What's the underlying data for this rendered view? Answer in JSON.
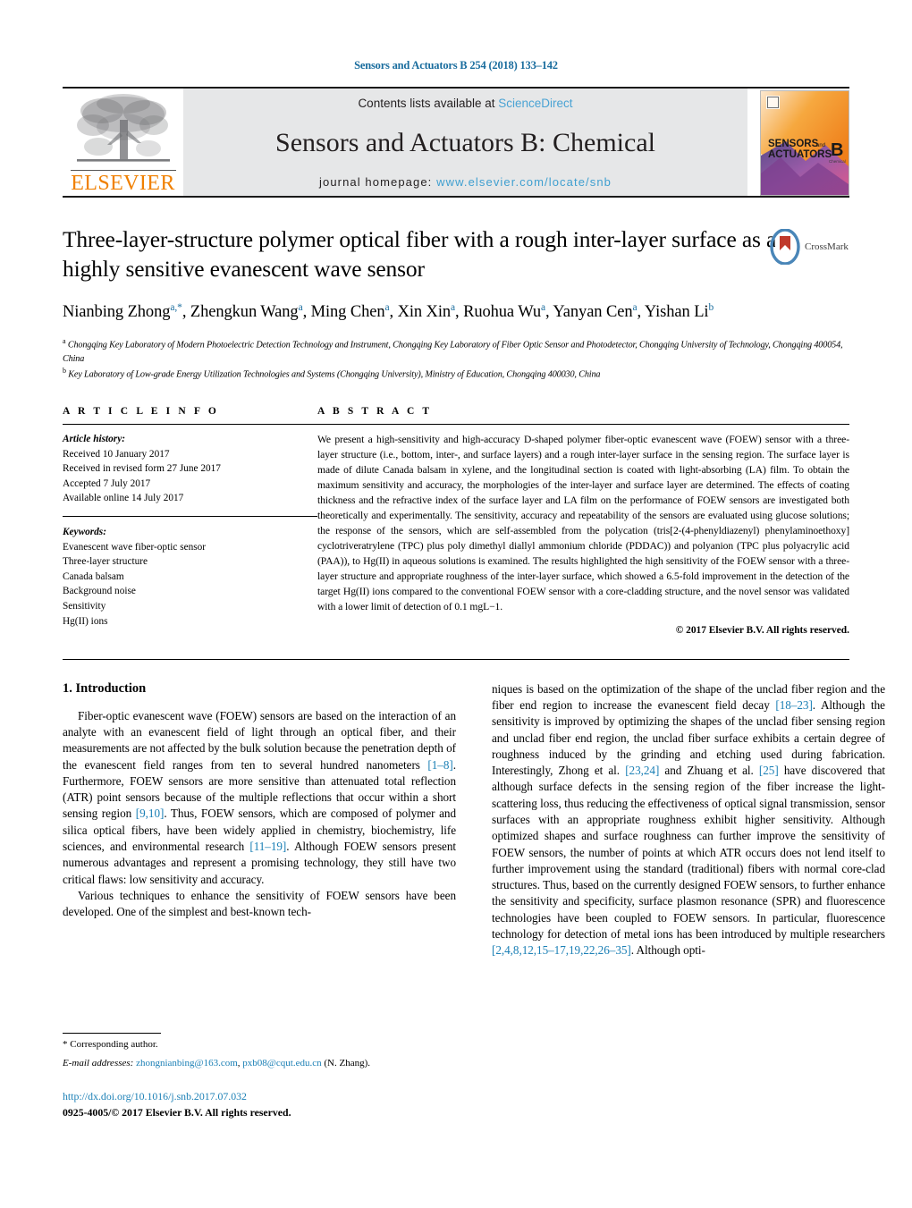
{
  "running_head": "Sensors and Actuators B 254 (2018) 133–142",
  "masthead": {
    "contents_prefix": "Contents lists available at ",
    "sciencedirect": "ScienceDirect",
    "journal_title": "Sensors and Actuators B: Chemical",
    "homepage_prefix": "journal homepage: ",
    "homepage_url": "www.elsevier.com/locate/snb",
    "publisher": "ELSEVIER",
    "cover": {
      "line1": "SENSORS",
      "line1_small": "and",
      "line2": "ACTUATORS",
      "letter": "B",
      "letter_sub": "Chemical"
    },
    "accent_link": "#3f9fd0",
    "panel_bg": "#e6e7e8"
  },
  "crossmark": {
    "label": "CrossMark"
  },
  "title": "Three-layer-structure polymer optical fiber with a rough inter-layer surface as a highly sensitive evanescent wave sensor",
  "authors_html": "Nianbing Zhong<sup>a,*</sup>, Zhengkun Wang<sup>a</sup>, Ming Chen<sup>a</sup>, Xin Xin<sup>a</sup>, Ruohua Wu<sup>a</sup>, Yanyan Cen<sup>a</sup>, Yishan Li<sup>b</sup>",
  "affiliations": [
    "Chongqing Key Laboratory of Modern Photoelectric Detection Technology and Instrument, Chongqing Key Laboratory of Fiber Optic Sensor and Photodetector, Chongqing University of Technology, Chongqing 400054, China",
    "Key Laboratory of Low-grade Energy Utilization Technologies and Systems (Chongqing University), Ministry of Education, Chongqing 400030, China"
  ],
  "article_info": {
    "heading": "A R T I C L E   I N F O",
    "history_label": "Article history:",
    "history": [
      "Received 10 January 2017",
      "Received in revised form 27 June 2017",
      "Accepted 7 July 2017",
      "Available online 14 July 2017"
    ],
    "keywords_label": "Keywords:",
    "keywords": [
      "Evanescent wave fiber-optic sensor",
      "Three-layer structure",
      "Canada balsam",
      "Background noise",
      "Sensitivity",
      "Hg(II) ions"
    ]
  },
  "abstract": {
    "heading": "A B S T R A C T",
    "text": "We present a high-sensitivity and high-accuracy D-shaped polymer fiber-optic evanescent wave (FOEW) sensor with a three-layer structure (i.e., bottom, inter-, and surface layers) and a rough inter-layer surface in the sensing region. The surface layer is made of dilute Canada balsam in xylene, and the longitudinal section is coated with light-absorbing (LA) film. To obtain the maximum sensitivity and accuracy, the morphologies of the inter-layer and surface layer are determined. The effects of coating thickness and the refractive index of the surface layer and LA film on the performance of FOEW sensors are investigated both theoretically and experimentally. The sensitivity, accuracy and repeatability of the sensors are evaluated using glucose solutions; the response of the sensors, which are self-assembled from the polycation (tris[2-(4-phenyldiazenyl) phenylaminoethoxy] cyclotriveratrylene (TPC) plus poly dimethyl diallyl ammonium chloride (PDDAC)) and polyanion (TPC plus polyacrylic acid (PAA)), to Hg(II) in aqueous solutions is examined. The results highlighted the high sensitivity of the FOEW sensor with a three-layer structure and appropriate roughness of the inter-layer surface, which showed a 6.5-fold improvement in the detection of the target Hg(II) ions compared to the conventional FOEW sensor with a core-cladding structure, and the novel sensor was validated with a lower limit of detection of 0.1 mgL−1.",
    "copyright": "© 2017 Elsevier B.V. All rights reserved."
  },
  "body": {
    "section_heading": "1.  Introduction",
    "left_paragraphs": [
      "Fiber-optic evanescent wave (FOEW) sensors are based on the interaction of an analyte with an evanescent field of light through an optical fiber, and their measurements are not affected by the bulk solution because the penetration depth of the evanescent field ranges from ten to several hundred nanometers [1–8]. Furthermore, FOEW sensors are more sensitive than attenuated total reflection (ATR) point sensors because of the multiple reflections that occur within a short sensing region [9,10]. Thus, FOEW sensors, which are composed of polymer and silica optical fibers, have been widely applied in chemistry, biochemistry, life sciences, and environmental research [11–19]. Although FOEW sensors present numerous advantages and represent a promising technology, they still have two critical flaws: low sensitivity and accuracy.",
      "Various techniques to enhance the sensitivity of FOEW sensors have been developed. One of the simplest and best-known tech-"
    ],
    "right_paragraphs": [
      "niques is based on the optimization of the shape of the unclad fiber region and the fiber end region to increase the evanescent field decay [18–23]. Although the sensitivity is improved by optimizing the shapes of the unclad fiber sensing region and unclad fiber end region, the unclad fiber surface exhibits a certain degree of roughness induced by the grinding and etching used during fabrication. Interestingly, Zhong et al. [23,24] and Zhuang et al. [25] have discovered that although surface defects in the sensing region of the fiber increase the light-scattering loss, thus reducing the effectiveness of optical signal transmission, sensor surfaces with an appropriate roughness exhibit higher sensitivity. Although optimized shapes and surface roughness can further improve the sensitivity of FOEW sensors, the number of points at which ATR occurs does not lend itself to further improvement using the standard (traditional) fibers with normal core-clad structures. Thus, based on the currently designed FOEW sensors, to further enhance the sensitivity and specificity, surface plasmon resonance (SPR) and fluorescence technologies have been coupled to FOEW sensors. In particular, fluorescence technology for detection of metal ions has been introduced by multiple researchers [2,4,8,12,15–17,19,22,26–35]. Although opti-"
    ]
  },
  "footnote": {
    "corresponding": "*  Corresponding author.",
    "email_label": "E-mail addresses:",
    "email1": "zhongnianbing@163.com",
    "email_sep": ", ",
    "email2": "pxb08@cqut.edu.cn",
    "email_suffix": " (N. Zhang)."
  },
  "footer": {
    "doi": "http://dx.doi.org/10.1016/j.snb.2017.07.032",
    "issn_line": "0925-4005/© 2017 Elsevier B.V. All rights reserved."
  },
  "colors": {
    "link_blue": "#1a7fb5",
    "head_blue": "#1a6d9e",
    "elsevier_orange": "#f08000"
  }
}
